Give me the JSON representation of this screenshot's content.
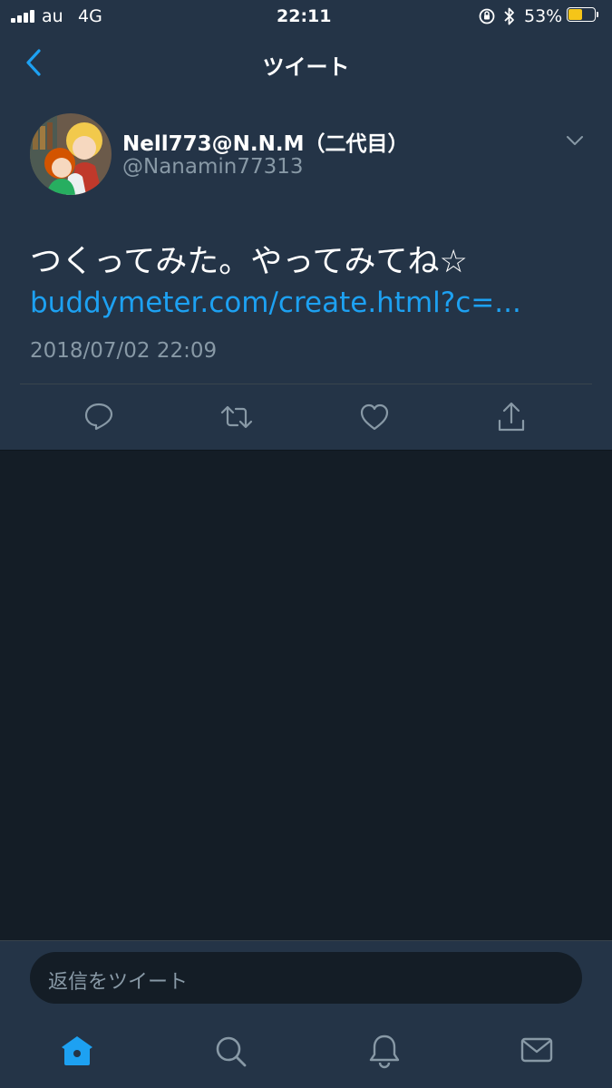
{
  "status_bar": {
    "carrier": "au",
    "network": "4G",
    "time": "22:11",
    "battery_percent": "53%",
    "battery_level": 0.53
  },
  "nav": {
    "title": "ツイート"
  },
  "tweet": {
    "display_name": "Nell773@N.N.M（二代目）",
    "handle": "@Nanamin77313",
    "text": "つくってみた。やってみてね☆",
    "link": "buddymeter.com/create.html?c=...",
    "timestamp": "2018/07/02 22:09"
  },
  "reply": {
    "placeholder": "返信をツイート"
  },
  "colors": {
    "background": "#141d26",
    "panel": "#243447",
    "accent": "#1da1f2",
    "muted": "#8899a6",
    "battery": "#f5c518"
  },
  "icons": {
    "back": "chevron-left-icon",
    "caret": "chevron-down-icon",
    "reply": "reply-icon",
    "retweet": "retweet-icon",
    "like": "heart-icon",
    "share": "share-icon",
    "home": "home-icon",
    "search": "search-icon",
    "notifications": "bell-icon",
    "messages": "mail-icon"
  }
}
